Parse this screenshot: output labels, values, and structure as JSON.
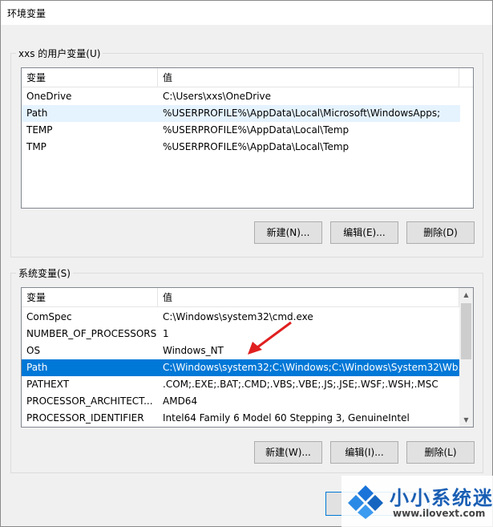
{
  "window": {
    "title": "环境变量"
  },
  "user_vars": {
    "group_label": "xxs 的用户变量(U)",
    "columns": [
      "变量",
      "值"
    ],
    "rows": [
      {
        "name": "OneDrive",
        "value": "C:\\Users\\xxs\\OneDrive"
      },
      {
        "name": "Path",
        "value": "%USERPROFILE%\\AppData\\Local\\Microsoft\\WindowsApps;"
      },
      {
        "name": "TEMP",
        "value": "%USERPROFILE%\\AppData\\Local\\Temp"
      },
      {
        "name": "TMP",
        "value": "%USERPROFILE%\\AppData\\Local\\Temp"
      }
    ],
    "buttons": {
      "new": "新建(N)...",
      "edit": "编辑(E)...",
      "delete": "删除(D)"
    }
  },
  "system_vars": {
    "group_label": "系统变量(S)",
    "columns": [
      "变量",
      "值"
    ],
    "rows": [
      {
        "name": "ComSpec",
        "value": "C:\\Windows\\system32\\cmd.exe"
      },
      {
        "name": "NUMBER_OF_PROCESSORS",
        "value": "1"
      },
      {
        "name": "OS",
        "value": "Windows_NT"
      },
      {
        "name": "Path",
        "value": "C:\\Windows\\system32;C:\\Windows;C:\\Windows\\System32\\Wb..."
      },
      {
        "name": "PATHEXT",
        "value": ".COM;.EXE;.BAT;.CMD;.VBS;.VBE;.JS;.JSE;.WSF;.WSH;.MSC"
      },
      {
        "name": "PROCESSOR_ARCHITECT...",
        "value": "AMD64"
      },
      {
        "name": "PROCESSOR_IDENTIFIER",
        "value": "Intel64 Family 6 Model 60 Stepping 3, GenuineIntel"
      }
    ],
    "selected_row": "Path",
    "buttons": {
      "new": "新建(W)...",
      "edit": "编辑(I)...",
      "delete": "删除(L)"
    }
  },
  "colors": {
    "selection": "#0078d7",
    "annotation_arrow": "#e02020",
    "watermark_blue": "#1a5fb4"
  },
  "watermark": {
    "title": "小小系统迷",
    "url": "www.ilovext.com"
  }
}
